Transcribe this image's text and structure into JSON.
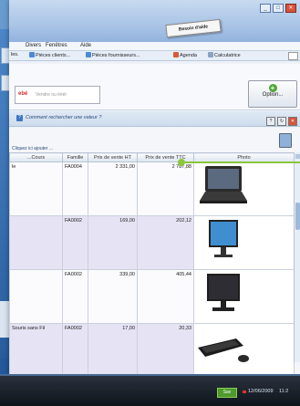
{
  "titlebar": {
    "besoin_label": "Besoin d'aide"
  },
  "menubar": {
    "items": [
      "Divers",
      "Fenêtres",
      "Aide"
    ]
  },
  "toolbar": {
    "items": [
      "Pièces clients...",
      "Pièces fournisseurs...",
      "Agenda",
      "Calculatrice"
    ],
    "left_item": "les."
  },
  "search": {
    "placeholder": "Vendre ou ééér",
    "logo": "ebé"
  },
  "options_button": {
    "label": "Option..."
  },
  "help": {
    "label": "Comment rechercher une valeur ?"
  },
  "grid": {
    "add_row_label": "Cliquez ici ajouter ...",
    "columns": [
      "...Cours",
      "Famille",
      "Prix de vente HT",
      "Prix de vente TTC",
      "Photo"
    ],
    "rows": [
      {
        "libelle": "le",
        "famille": "FA0004",
        "ht": "2 331,00",
        "ttc": "2 787,88",
        "photo": "laptop-photo"
      },
      {
        "libelle": "",
        "famille": "FA0002",
        "ht": "169,00",
        "ttc": "202,12",
        "photo": "lcd-monitor-photo"
      },
      {
        "libelle": "",
        "famille": "FA0002",
        "ht": "339,00",
        "ttc": "405,44",
        "photo": "monitor-photo"
      },
      {
        "libelle": "Souris sans Fil",
        "famille": "FA0002",
        "ht": "17,00",
        "ttc": "20,33",
        "photo": "keyboard-mouse-photo"
      }
    ]
  },
  "taskbar": {
    "tray_badge": "Sav",
    "date": "12/06/2009",
    "time": "11:2"
  }
}
